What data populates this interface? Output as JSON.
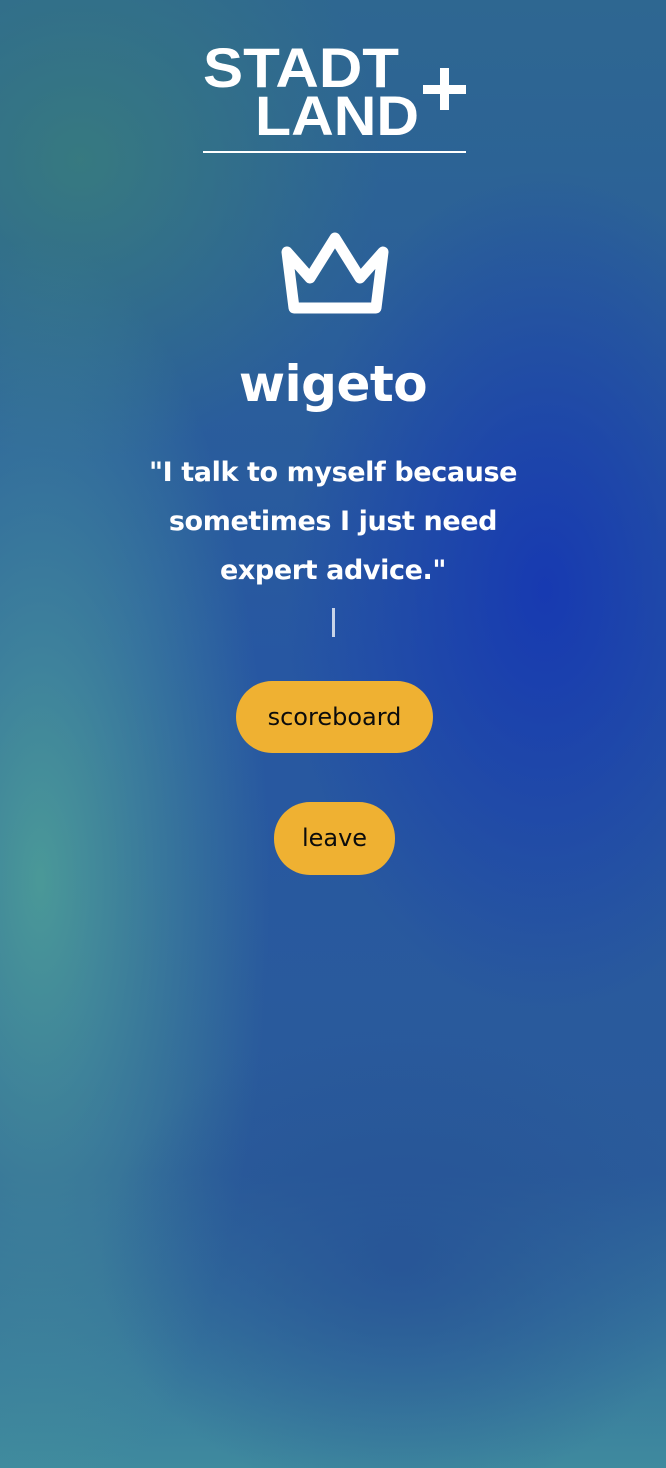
{
  "logo": {
    "line1": "STADT",
    "line2": "LAND",
    "plus": "+"
  },
  "winner": {
    "icon": "crown-icon",
    "name": "wigeto",
    "quote_line1": "\"I talk to myself because",
    "quote_line2": "sometimes I just need",
    "quote_line3": "expert advice.\""
  },
  "buttons": {
    "scoreboard_label": "scoreboard",
    "leave_label": "leave"
  },
  "colors": {
    "button_bg": "#efb132",
    "button_text": "#0c0c0c",
    "text": "#ffffff"
  }
}
